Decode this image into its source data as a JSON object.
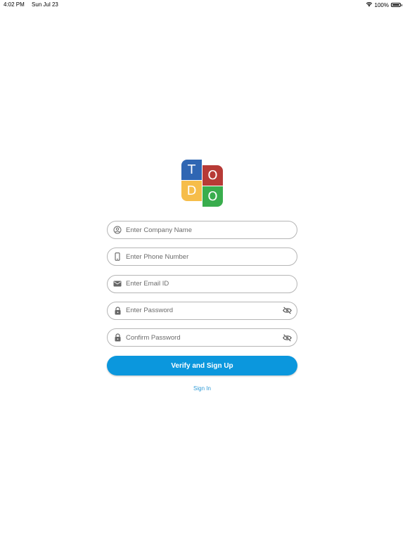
{
  "status_bar": {
    "time": "4:02 PM",
    "date": "Sun Jul 23",
    "battery": "100%",
    "wifi_icon": "wifi-icon",
    "battery_icon": "battery-icon"
  },
  "logo": {
    "letters": [
      "T",
      "O",
      "D",
      "O"
    ],
    "colors": [
      "#2f66b3",
      "#b73a36",
      "#f6bd4a",
      "#39ad4d"
    ]
  },
  "form": {
    "company": {
      "placeholder": "Enter Company Name",
      "value": "",
      "icon": "user-circle-icon"
    },
    "phone": {
      "placeholder": "Enter Phone Number",
      "value": "",
      "icon": "phone-icon"
    },
    "email": {
      "placeholder": "Enter Email ID",
      "value": "",
      "icon": "mail-icon"
    },
    "password": {
      "placeholder": "Enter Password",
      "value": "",
      "icon": "lock-icon",
      "toggle_icon": "eye-off-icon"
    },
    "confirm_password": {
      "placeholder": "Confirm Password",
      "value": "",
      "icon": "lock-icon",
      "toggle_icon": "eye-off-icon"
    },
    "submit_label": "Verify and Sign Up",
    "signin_label": "Sign In"
  },
  "colors": {
    "primary": "#0b97dd",
    "link": "#2f9bd6",
    "field_border": "#b5b5b5"
  }
}
